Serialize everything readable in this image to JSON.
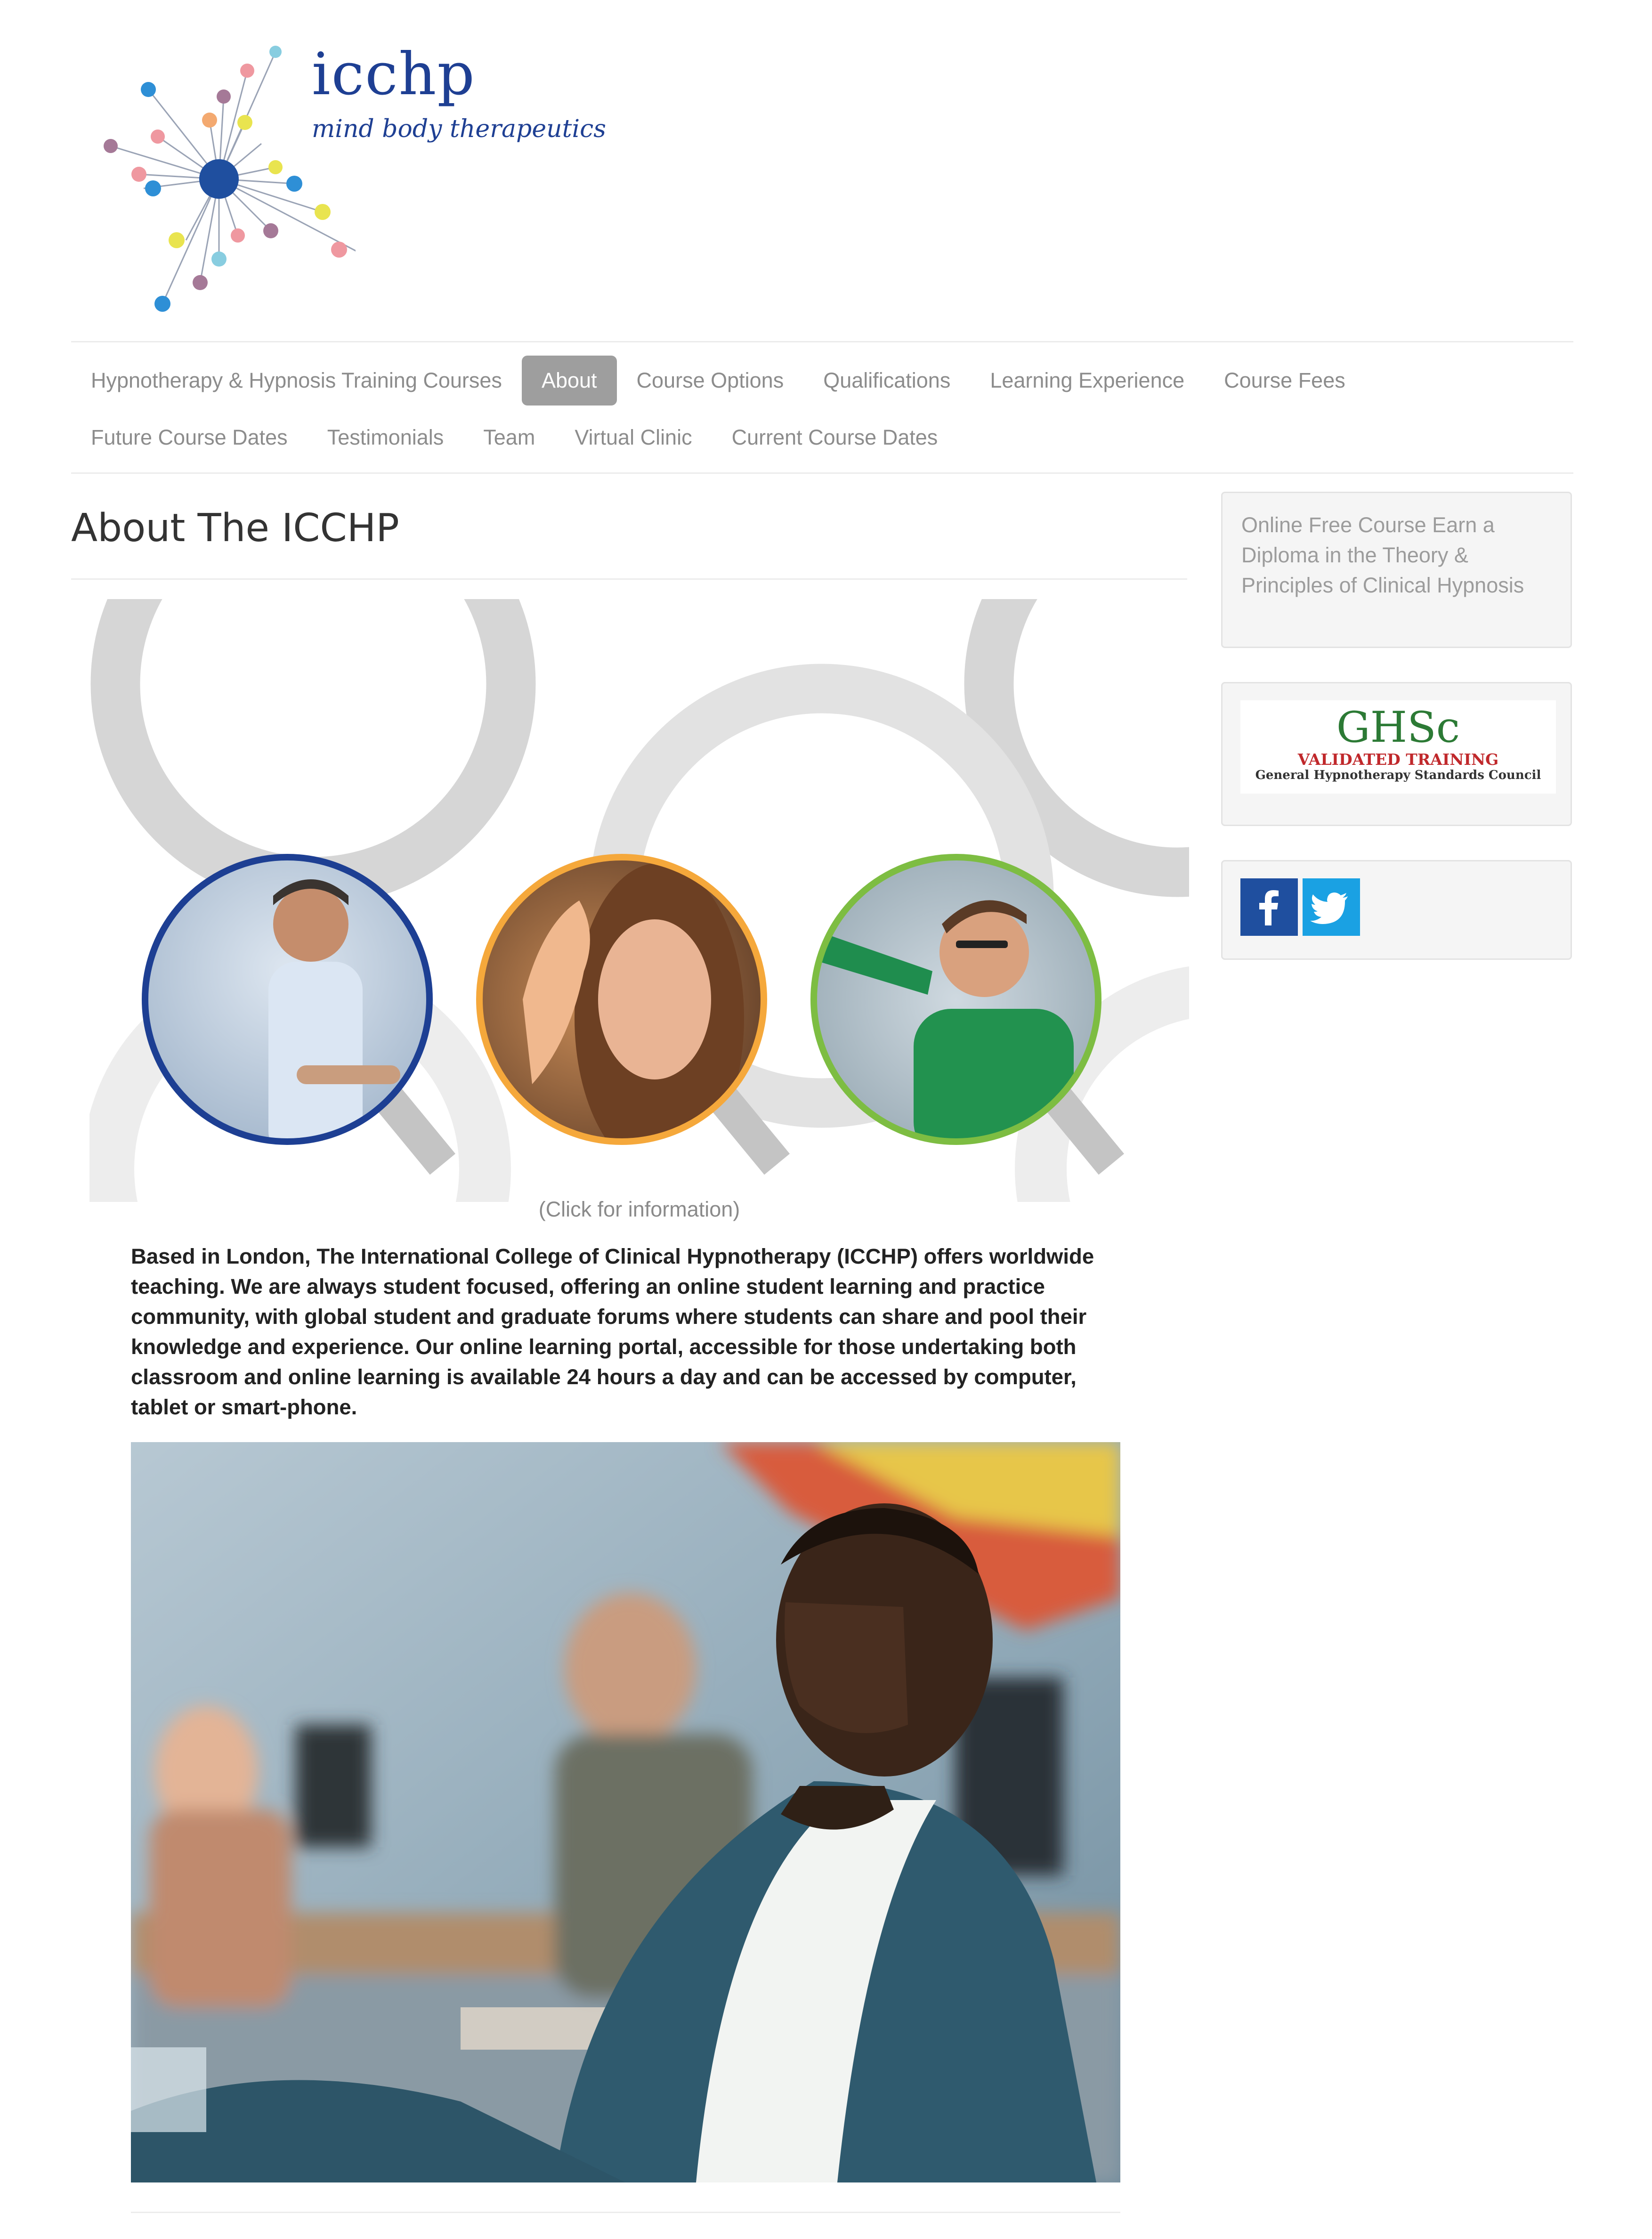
{
  "brand": {
    "name": "icchp",
    "tagline": "mind body therapeutics",
    "colors": {
      "primary_blue": "#1e3f93",
      "logo_dots": [
        "#2e8fd6",
        "#ef98a0",
        "#a57997",
        "#e9e44f",
        "#f3a970",
        "#88cde0"
      ]
    }
  },
  "nav": {
    "row1": [
      {
        "label": "Hypnotherapy & Hypnosis Training Courses",
        "active": false
      },
      {
        "label": "About",
        "active": true
      },
      {
        "label": "Course Options",
        "active": false
      },
      {
        "label": "Qualifications",
        "active": false
      },
      {
        "label": "Learning Experience",
        "active": false
      },
      {
        "label": "Course Fees",
        "active": false
      }
    ],
    "row2": [
      {
        "label": "Future Course Dates",
        "active": false
      },
      {
        "label": "Testimonials",
        "active": false
      },
      {
        "label": "Team",
        "active": false
      },
      {
        "label": "Virtual Clinic",
        "active": false
      },
      {
        "label": "Current Course Dates",
        "active": false
      }
    ]
  },
  "main": {
    "title": "About The ICCHP",
    "hero": {
      "caption": "(Click for information)",
      "ring_colors": [
        "#1d3f93",
        "#f5a83b",
        "#7dbd42"
      ],
      "photos": [
        "tutor-photo",
        "student-woman-photo",
        "student-man-photo"
      ]
    },
    "intro": "Based in London, The International College of Clinical Hypnotherapy (ICCHP) offers worldwide teaching. We are always student focused, offering an online student learning and practice community, with global student and graduate forums where students can share and pool their knowledge and experience. Our online learning portal, accessible for those undertaking both classroom and online learning is available 24 hours a day and can be accessed by computer, tablet or smart-phone."
  },
  "sidebar": {
    "promo": "Online Free Course Earn a Diploma in the Theory & Principles of Clinical Hypnosis",
    "ghsc": {
      "title": "GHSc",
      "line1": "VALIDATED TRAINING",
      "line2": "General Hypnotherapy Standards Council"
    },
    "social": {
      "facebook_icon": "f",
      "twitter_icon": "twitter-bird",
      "facebook_color": "#1f4f9f",
      "twitter_color": "#1aa1e3"
    }
  }
}
